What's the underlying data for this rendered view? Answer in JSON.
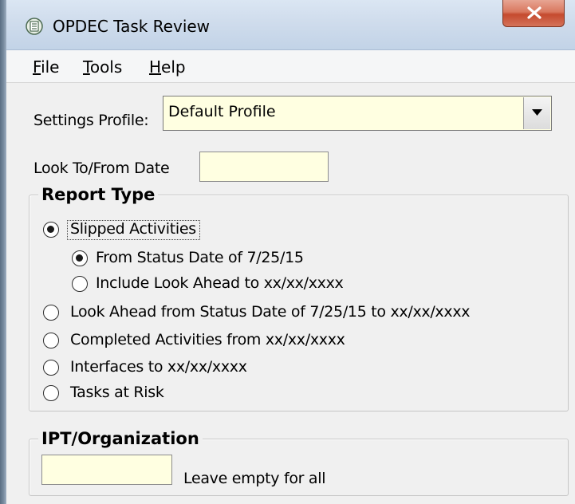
{
  "window": {
    "title": "OPDEC Task Review"
  },
  "menu": {
    "file": {
      "u": "F",
      "rest": "ile"
    },
    "tools": {
      "u": "T",
      "rest": "ools"
    },
    "help": {
      "u": "H",
      "rest": "elp"
    }
  },
  "settings": {
    "label": "Settings Profile:",
    "selected": "Default Profile"
  },
  "look_date": {
    "label": "Look To/From Date",
    "value": ""
  },
  "report_type": {
    "title": "Report Type",
    "options": [
      {
        "label": "Slipped Activities",
        "checked": true
      },
      {
        "label": "From Status Date of 7/25/15",
        "checked": true
      },
      {
        "label": "Include Look Ahead to xx/xx/xxxx",
        "checked": false
      },
      {
        "label": "Look Ahead from Status Date of 7/25/15 to xx/xx/xxxx",
        "checked": false
      },
      {
        "label": "Completed Activities from xx/xx/xxxx",
        "checked": false
      },
      {
        "label": "Interfaces to xx/xx/xxxx",
        "checked": false
      },
      {
        "label": "Tasks at Risk",
        "checked": false
      }
    ]
  },
  "ipt": {
    "title": "IPT/Organization",
    "value": "",
    "hint": "Leave empty for all"
  },
  "colors": {
    "input_bg": "#ffffe1",
    "close_button": "#c54a2e",
    "titlebar": "#cfdcec"
  },
  "icons": {
    "app": "opdec-app-icon",
    "close": "close-icon",
    "dropdown": "chevron-down-icon"
  }
}
